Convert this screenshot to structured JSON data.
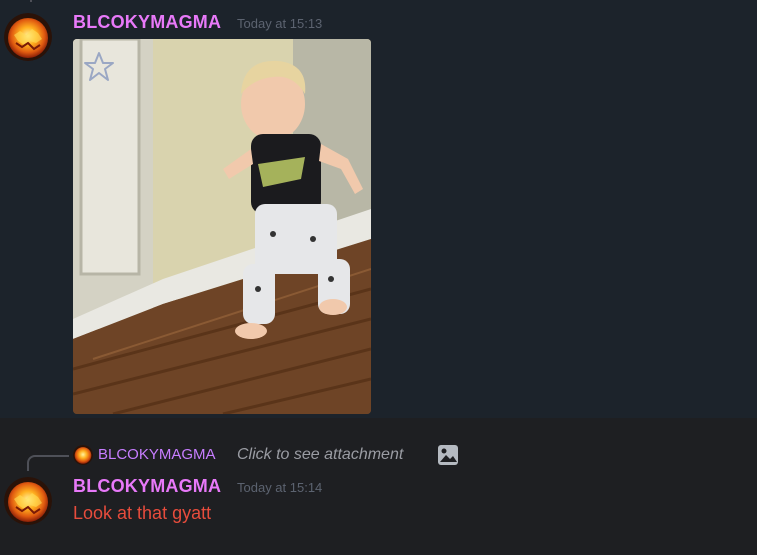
{
  "messages": [
    {
      "username": "BLCOKYMAGMA",
      "timestamp": "Today at 15:13",
      "attachment": {
        "type": "video",
        "subject": "toddler walking on wood floor"
      }
    },
    {
      "username": "BLCOKYMAGMA",
      "timestamp": "Today at 15:14",
      "reply": {
        "username": "BLCOKYMAGMA",
        "text": "Click to see attachment"
      },
      "content": "Look at that gyatt"
    }
  ],
  "icons": {
    "star": "star-icon",
    "image": "image-icon"
  },
  "colors": {
    "username": "#e879f9",
    "reply_username": "#c77dff",
    "message_text": "#e74c3c",
    "highlight_bg": "#1c232b",
    "bg": "#1e1f22"
  }
}
